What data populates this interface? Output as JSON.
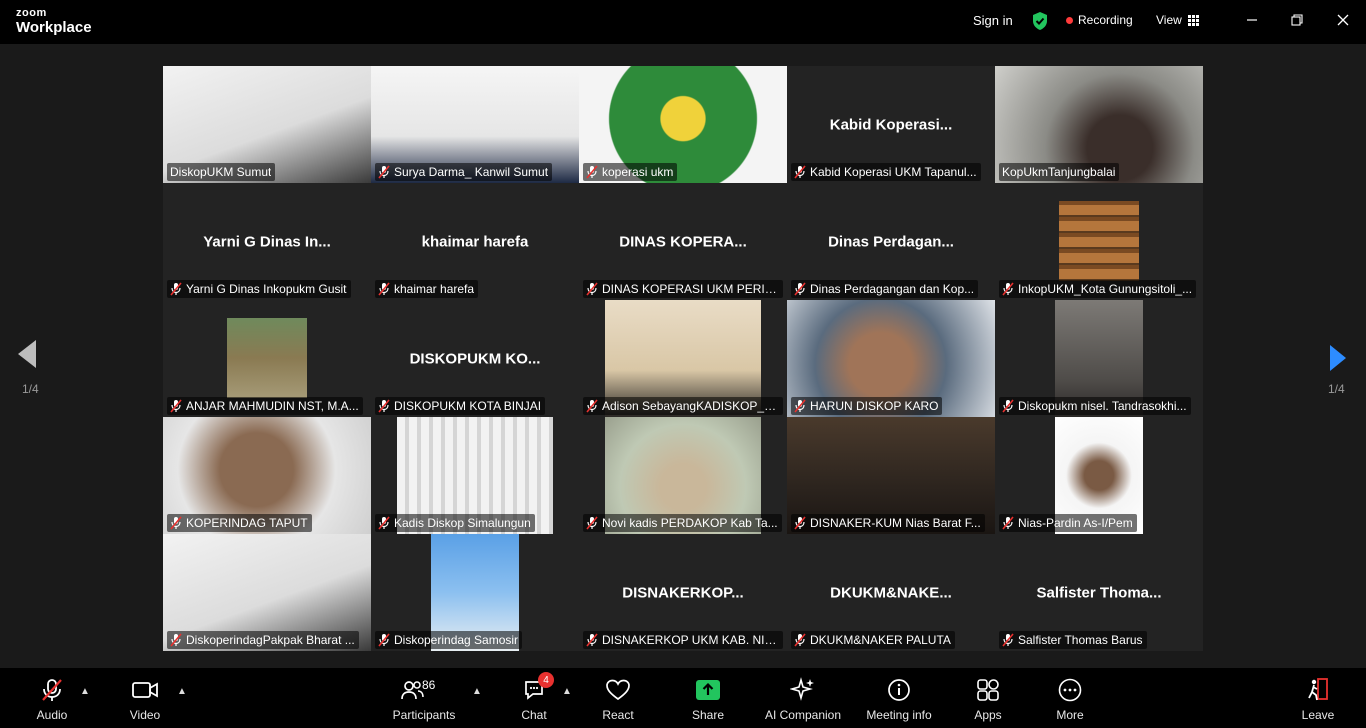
{
  "app": {
    "brand_small": "zoom",
    "brand_big": "Workplace"
  },
  "titlebar": {
    "sign_in": "Sign in",
    "recording": "Recording",
    "view": "View"
  },
  "colors": {
    "active_speaker": "#30d158",
    "accent": "#2d8cff",
    "share": "#22c55e",
    "record": "#ff3b3b",
    "badge": "#e8312f"
  },
  "pagination": {
    "left": "1/4",
    "right": "1/4"
  },
  "tiles": [
    {
      "name": "DiskopUKM Sumut",
      "big": "",
      "muted": false,
      "video": true,
      "img": "bright"
    },
    {
      "name": "Surya Darma_ Kanwil Sumut",
      "big": "",
      "muted": true,
      "video": true,
      "img": "light"
    },
    {
      "name": "koperasi ukm",
      "big": "",
      "muted": true,
      "video": true,
      "img": "emblem"
    },
    {
      "name": "Kabid Koperasi UKM Tapanul...",
      "big": "Kabid Koperasi...",
      "muted": true,
      "video": false,
      "img": ""
    },
    {
      "name": "KopUkmTanjungbalai",
      "big": "",
      "muted": false,
      "video": true,
      "img": "blur",
      "active": true
    },
    {
      "name": "Yarni G Dinas Inkopukm Gusit",
      "big": "Yarni G Dinas In...",
      "muted": true,
      "video": false,
      "img": ""
    },
    {
      "name": "khaimar harefa",
      "big": "khaimar harefa",
      "muted": true,
      "video": false,
      "img": ""
    },
    {
      "name": "DINAS KOPERASI UKM PERIN...",
      "big": "DINAS KOPERA...",
      "muted": true,
      "video": false,
      "img": ""
    },
    {
      "name": "Dinas Perdagangan dan Kop...",
      "big": "Dinas Perdagan...",
      "muted": true,
      "video": false,
      "img": ""
    },
    {
      "name": "InkopUKM_Kota Gunungsitoli_...",
      "big": "",
      "muted": true,
      "video": true,
      "img": "books"
    },
    {
      "name": "ANJAR MAHMUDIN NST, M.A...",
      "big": "",
      "muted": true,
      "video": true,
      "img": "landscape"
    },
    {
      "name": "DISKOPUKM KOTA BINJAI",
      "big": "DISKOPUKM KO...",
      "muted": true,
      "video": false,
      "img": ""
    },
    {
      "name": "Adison SebayangKADISKOP_K...",
      "big": "",
      "muted": true,
      "video": true,
      "img": "office"
    },
    {
      "name": "HARUN DISKOP KARO",
      "big": "",
      "muted": true,
      "video": true,
      "img": "man"
    },
    {
      "name": "Diskopukm nisel. Tandrasokhi...",
      "big": "",
      "muted": true,
      "video": true,
      "img": "dim"
    },
    {
      "name": "KOPERINDAG TAPUT",
      "big": "",
      "muted": true,
      "video": true,
      "img": "glasses"
    },
    {
      "name": "Kadis Diskop Simalungun",
      "big": "",
      "muted": true,
      "video": true,
      "img": "curtain"
    },
    {
      "name": "Novi kadis PERDAKOP Kab Ta...",
      "big": "",
      "muted": true,
      "video": true,
      "img": "woman"
    },
    {
      "name": "DISNAKER-KUM Nias Barat F...",
      "big": "",
      "muted": true,
      "video": true,
      "img": "darkroom"
    },
    {
      "name": "Nias-Pardin As-I/Pem",
      "big": "",
      "muted": true,
      "video": true,
      "img": "white"
    },
    {
      "name": "DiskoperindagPakpak Bharat ...",
      "big": "",
      "muted": true,
      "video": true,
      "img": "bright"
    },
    {
      "name": "Diskoperindag Samosir",
      "big": "",
      "muted": true,
      "video": true,
      "img": "sky"
    },
    {
      "name": "DISNAKERKOP UKM KAB. NIA...",
      "big": "DISNAKERKOP...",
      "muted": true,
      "video": false,
      "img": ""
    },
    {
      "name": "DKUKM&NAKER PALUTA",
      "big": "DKUKM&NAKE...",
      "muted": true,
      "video": false,
      "img": ""
    },
    {
      "name": "Salfister Thomas Barus",
      "big": "Salfister Thoma...",
      "muted": true,
      "video": false,
      "img": ""
    }
  ],
  "toolbar": {
    "audio": "Audio",
    "video": "Video",
    "participants": "Participants",
    "participants_count": "86",
    "chat": "Chat",
    "chat_badge": "4",
    "react": "React",
    "share": "Share",
    "ai": "AI Companion",
    "meeting_info": "Meeting info",
    "apps": "Apps",
    "more": "More",
    "leave": "Leave"
  }
}
